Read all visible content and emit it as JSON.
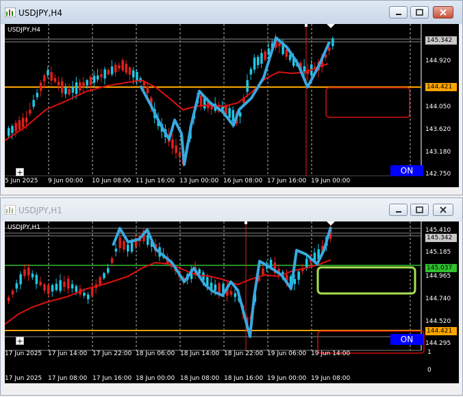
{
  "top_window": {
    "title": "USDJPY,H4",
    "symbol_label": "USDJPY,H4",
    "price_labels": [
      "144.920",
      "144.050",
      "143.620",
      "143.180",
      "142.750"
    ],
    "current_price": "145.342",
    "line_price": "144.421",
    "time_labels": [
      "5 Jun 2025",
      "9 Jun 00:00",
      "10 Jun 08:00",
      "11 Jun 16:00",
      "13 Jun 00:00",
      "16 Jun 08:00",
      "17 Jun 16:00",
      "19 Jun 00:00"
    ],
    "on_label": "ON",
    "plus_label": "+"
  },
  "bottom_window": {
    "title": "USDJPY,H1",
    "symbol_label": "USDJPY,H1",
    "price_labels": [
      "145.410",
      "145.185",
      "144.965",
      "144.740",
      "144.520",
      "144.295"
    ],
    "current_price": "145.342",
    "green_price": "145.037",
    "line_price": "144.421",
    "time_labels_top": [
      "17 Jun 2025",
      "17 Jun 14:00",
      "17 Jun 22:00",
      "18 Jun 06:00",
      "18 Jun 14:00",
      "18 Jun 22:00",
      "19 Jun 06:00",
      "19 Jun 14:00"
    ],
    "time_labels_bottom": [
      "17 Jun 2025",
      "17 Jun 08:00",
      "17 Jun 16:00",
      "18 Jun 00:00",
      "18 Jun 08:00",
      "18 Jun 16:00",
      "19 Jun 00:00",
      "19 Jun 08:00"
    ],
    "sub_labels": [
      "1",
      "0"
    ],
    "on_label": "ON",
    "plus_label": "+"
  },
  "colors": {
    "bull": "#1ec8e6",
    "bear": "#e0201c",
    "ma": "#e01010",
    "drawing": "#38a8e0",
    "orange_line": "#ffa500",
    "green_line": "#30c030",
    "red_box": "#d01010",
    "green_box": "#a8e050"
  }
}
